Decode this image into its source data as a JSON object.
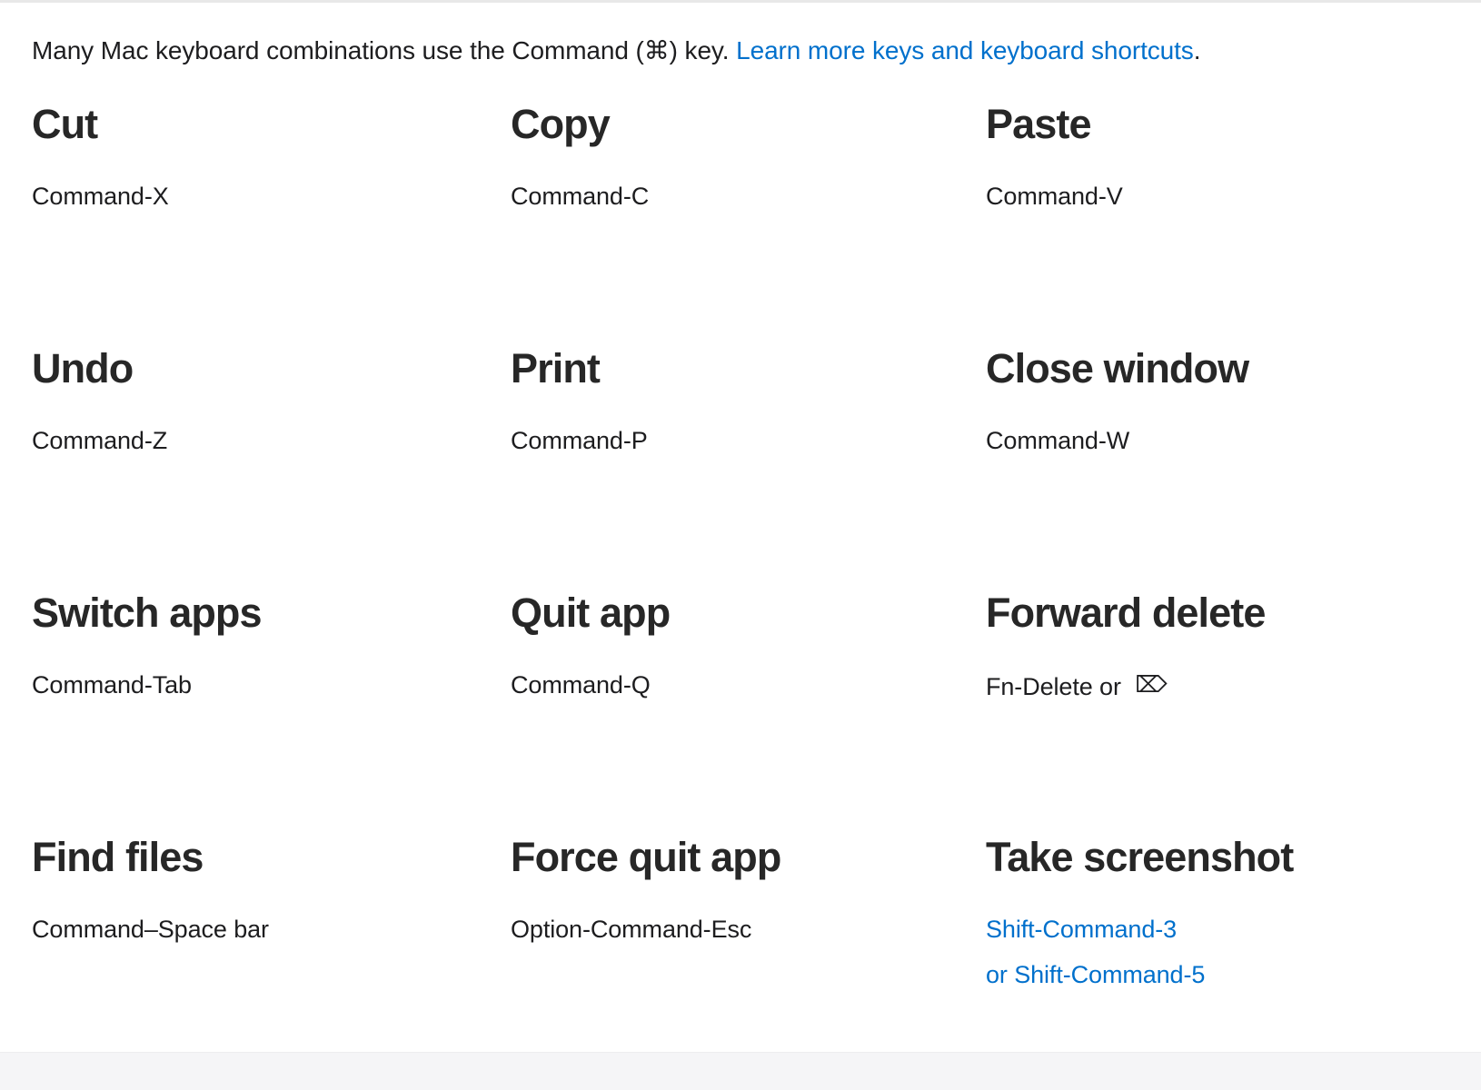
{
  "intro": {
    "text_before_link": "Many Mac keyboard combinations use the Command (",
    "command_symbol": "⌘",
    "text_after_symbol": ") key. ",
    "link_label": "Learn more keys and keyboard shortcuts",
    "text_end": "."
  },
  "colors": {
    "link_blue": "#0070cc",
    "heading_dark": "#272727",
    "body_text": "#1d1d1f",
    "footer_band": "#f5f5f7",
    "page_background": "#ffffff"
  },
  "shortcuts": [
    [
      {
        "title": "Cut",
        "desc": "Command-X"
      },
      {
        "title": "Copy",
        "desc": "Command-C"
      },
      {
        "title": "Paste",
        "desc": "Command-V"
      }
    ],
    [
      {
        "title": "Undo",
        "desc": "Command-Z"
      },
      {
        "title": "Print",
        "desc": "Command-P"
      },
      {
        "title": "Close window",
        "desc": "Command-W"
      }
    ],
    [
      {
        "title": "Switch apps",
        "desc": "Command-Tab"
      },
      {
        "title": "Quit app",
        "desc": "Command-Q"
      },
      {
        "title": "Forward delete",
        "desc": "Fn-Delete or ",
        "glyph": "⌦",
        "glyph_name": "forward-delete-icon"
      }
    ],
    [
      {
        "title": "Find files",
        "desc": "Command–Space bar"
      },
      {
        "title": "Force quit app",
        "desc": "Option-Command-Esc"
      },
      {
        "title": "Take screenshot",
        "links": [
          "Shift-Command-3",
          "or Shift-Command-5"
        ]
      }
    ]
  ]
}
